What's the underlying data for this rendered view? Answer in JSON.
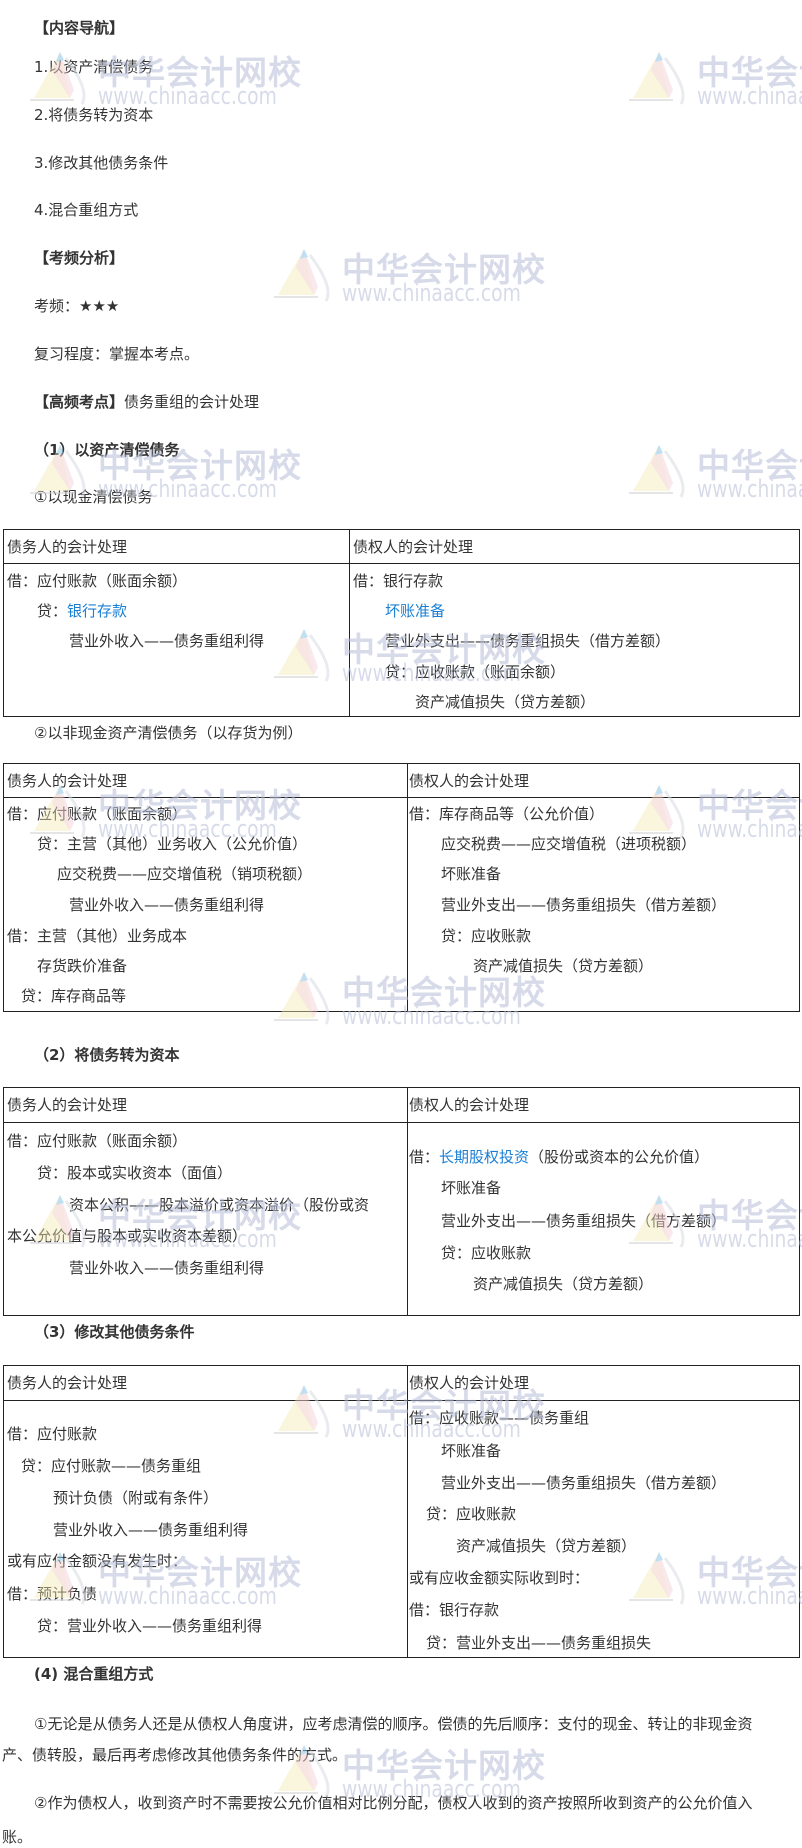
{
  "nav_title": "【内容导航】",
  "nav_items": [
    "1.以资产清偿债务",
    "2.将债务转为资本",
    "3.修改其他债务条件",
    "4.混合重组方式"
  ],
  "freq_title": "【考频分析】",
  "freq_label": "考频：",
  "freq_stars": "★★★",
  "review": "复习程度：掌握本考点。",
  "key_title": "【高频考点】",
  "key_text": "债务重组的会计处理",
  "s1": {
    "title": "（1）以资产清偿债务",
    "sub1": "①以现金清偿债务",
    "t1": {
      "h_left": "债务人的会计处理",
      "h_right": "债权人的会计处理",
      "left": [
        "借：应付账款（账面余额）",
        "贷：",
        "银行存款",
        "营业外收入——债务重组利得"
      ],
      "right": [
        "借：银行存款",
        "坏账准备",
        "营业外支出——债务重组损失（借方差额）",
        "贷：应收账款（账面余额）",
        "资产减值损失（贷方差额）"
      ]
    },
    "sub2": "②以非现金资产清偿债务（以存货为例）",
    "t2": {
      "h_left": "债务人的会计处理",
      "h_right": "债权人的会计处理",
      "left": [
        "借：应付账款（账面余额）",
        "贷：主营（其他）业务收入（公允价值）",
        "应交税费——应交增值税（销项税额）",
        "营业外收入——债务重组利得",
        "借：主营（其他）业务成本",
        "存货跌价准备",
        "贷：库存商品等"
      ],
      "right": [
        "借：库存商品等（公允价值）",
        "应交税费——应交增值税（进项税额）",
        "坏账准备",
        "营业外支出——债务重组损失（借方差额）",
        "贷：应收账款",
        "资产减值损失（贷方差额）"
      ]
    }
  },
  "s2": {
    "title": "（2）将债务转为资本",
    "t": {
      "h_left": "债务人的会计处理",
      "h_right": "债权人的会计处理",
      "left": [
        "借：应付账款（账面余额）",
        "贷：股本或实收资本（面值）",
        "资本公积——股本溢价或资本溢价（股份或资",
        "本公允价值与股本或实收资本差额）",
        "营业外收入——债务重组利得"
      ],
      "right": [
        "借：",
        "长期股权投资",
        "（股份或资本的公允价值）",
        "坏账准备",
        "营业外支出——债务重组损失（借方差额）",
        "贷：应收账款",
        "资产减值损失（贷方差额）"
      ]
    }
  },
  "s3": {
    "title": "（3）修改其他债务条件",
    "t": {
      "h_left": "债务人的会计处理",
      "h_right": "债权人的会计处理",
      "left": [
        "借：应付账款",
        "贷：应付账款——债务重组",
        "预计负债（附或有条件）",
        "营业外收入——债务重组利得",
        "或有应付金额没有发生时：",
        "借：预计负债",
        "贷：营业外收入——债务重组利得"
      ],
      "right": [
        "借：应收账款——债务重组",
        "坏账准备",
        "营业外支出——债务重组损失（借方差额）",
        "贷：应收账款",
        "资产减值损失（贷方差额）",
        "或有应收金额实际收到时：",
        "借：银行存款",
        "贷：营业外支出——债务重组损失"
      ]
    }
  },
  "s4": {
    "title": "(4) 混合重组方式",
    "p1a": "①无论是从债务人还是从债权人角度讲，应考虑清偿的顺序。偿债的先后顺序：支付的现金、转让的非现金资",
    "p1b": "产、债转股，最后再考虑修改其他债务条件的方式。",
    "p2a": "②作为债权人，收到资产时不需要按公允价值相对比例分配，债权人收到的资产按照所收到资产的公允价值入",
    "p2b": "账。"
  },
  "watermark": {
    "name": "中华会计网校",
    "url": "www.chinaacc.com"
  },
  "colors": {
    "link_blue": "#1a7fd4",
    "text": "#333333",
    "border": "#222222"
  }
}
